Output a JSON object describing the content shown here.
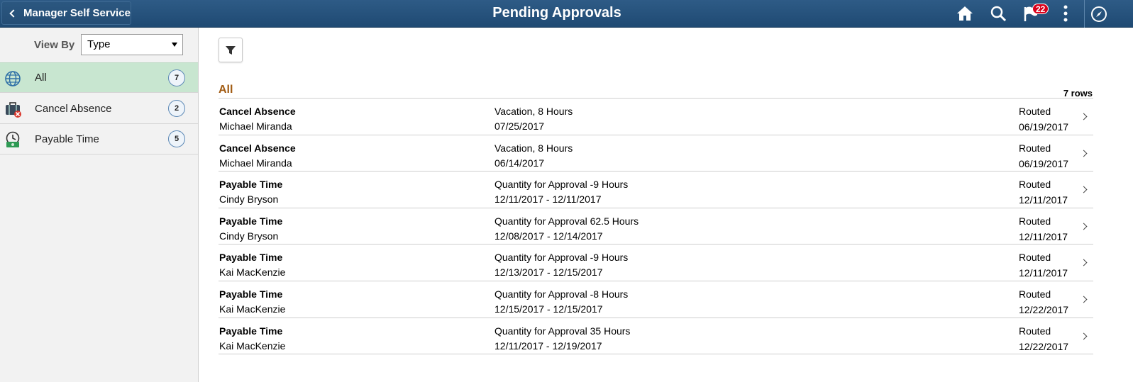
{
  "header": {
    "back_label": "Manager Self Service",
    "title": "Pending Approvals",
    "notification_count": "22",
    "icons": [
      "home-icon",
      "search-icon",
      "notification-flag-icon",
      "actions-menu-icon",
      "navbar-compass-icon"
    ]
  },
  "sidebar": {
    "view_by_label": "View By",
    "view_by_value": "Type",
    "items": [
      {
        "label": "All",
        "count": "7",
        "icon": "globe-icon"
      },
      {
        "label": "Cancel Absence",
        "count": "2",
        "icon": "briefcase-cancel-icon"
      },
      {
        "label": "Payable Time",
        "count": "5",
        "icon": "clock-money-icon"
      }
    ]
  },
  "main": {
    "group_title": "All",
    "row_count": "7 rows",
    "rows": [
      {
        "type": "Cancel Absence",
        "name": "Michael Miranda",
        "detail": "Vacation, 8 Hours",
        "dates": "07/25/2017",
        "status": "Routed",
        "status_date": "06/19/2017"
      },
      {
        "type": "Cancel Absence",
        "name": "Michael Miranda",
        "detail": "Vacation, 8 Hours",
        "dates": "06/14/2017",
        "status": "Routed",
        "status_date": "06/19/2017"
      },
      {
        "type": "Payable Time",
        "name": "Cindy Bryson",
        "detail": "Quantity for Approval -9 Hours",
        "dates": "12/11/2017 - 12/11/2017",
        "status": "Routed",
        "status_date": "12/11/2017"
      },
      {
        "type": "Payable Time",
        "name": "Cindy Bryson",
        "detail": "Quantity for Approval 62.5 Hours",
        "dates": "12/08/2017 - 12/14/2017",
        "status": "Routed",
        "status_date": "12/11/2017"
      },
      {
        "type": "Payable Time",
        "name": "Kai MacKenzie",
        "detail": "Quantity for Approval -9 Hours",
        "dates": "12/13/2017 - 12/15/2017",
        "status": "Routed",
        "status_date": "12/11/2017"
      },
      {
        "type": "Payable Time",
        "name": "Kai MacKenzie",
        "detail": "Quantity for Approval -8 Hours",
        "dates": "12/15/2017 - 12/15/2017",
        "status": "Routed",
        "status_date": "12/22/2017"
      },
      {
        "type": "Payable Time",
        "name": "Kai MacKenzie",
        "detail": "Quantity for Approval 35 Hours",
        "dates": "12/11/2017 - 12/19/2017",
        "status": "Routed",
        "status_date": "12/22/2017"
      }
    ]
  },
  "colors": {
    "header": "#2a5580",
    "accent_active": "#c8e6d0",
    "group_title": "#a15b12",
    "badge": "#d9001b"
  }
}
